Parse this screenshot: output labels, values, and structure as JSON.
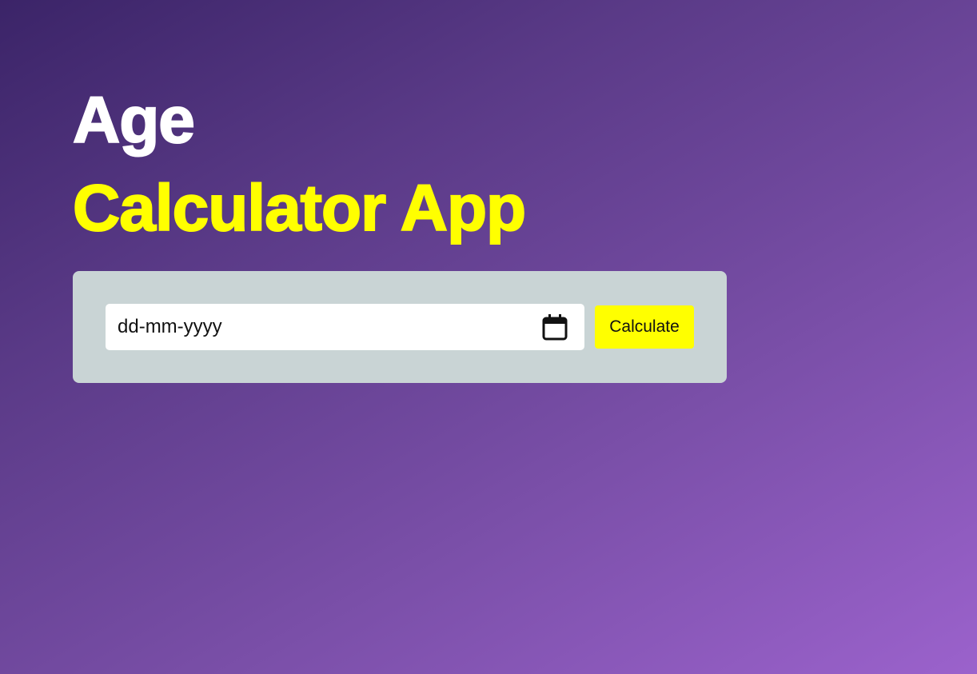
{
  "header": {
    "title_line1": "Age",
    "title_line2": "Calculator App"
  },
  "form": {
    "date_placeholder": "dd-mm-yyyy",
    "calendar_icon": "calendar-icon",
    "calculate_label": "Calculate"
  },
  "colors": {
    "accent": "#ffff00",
    "title_primary": "#ffffff",
    "card_background": "#c9d4d5",
    "background_start": "#3b2468",
    "background_end": "#9b62cc"
  }
}
